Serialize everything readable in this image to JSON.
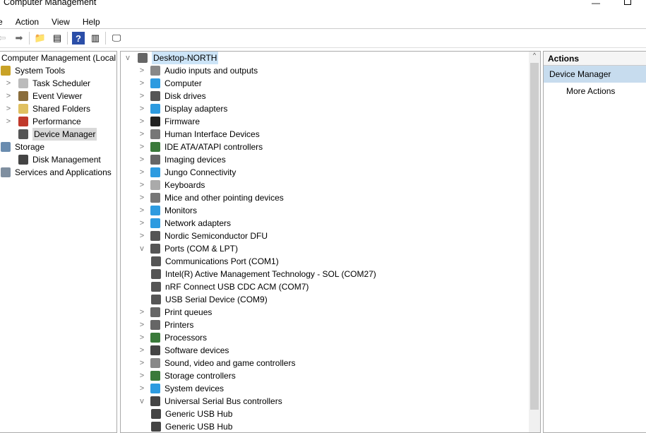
{
  "window": {
    "title": "Computer Management"
  },
  "menu": [
    "e",
    "Action",
    "View",
    "Help"
  ],
  "toolbar": [
    "back-icon",
    "forward-icon",
    "up-folder-icon",
    "show-hide-tree-icon",
    "help-icon",
    "show-hide-action-pane-icon",
    "monitor-icon"
  ],
  "left_tree": [
    {
      "label": "Computer Management (Local",
      "level": 0,
      "chev": ""
    },
    {
      "label": "System Tools",
      "level": 1,
      "chev": "",
      "color": "#c9a227"
    },
    {
      "label": "Task Scheduler",
      "level": 2,
      "chev": ">",
      "color": "#bbbbbb"
    },
    {
      "label": "Event Viewer",
      "level": 2,
      "chev": ">",
      "color": "#8a6d3b"
    },
    {
      "label": "Shared Folders",
      "level": 2,
      "chev": ">",
      "color": "#e0c060"
    },
    {
      "label": "Performance",
      "level": 2,
      "chev": ">",
      "color": "#c0392b"
    },
    {
      "label": "Device Manager",
      "level": 2,
      "chev": "",
      "color": "#555555",
      "selected": true
    },
    {
      "label": "Storage",
      "level": 1,
      "chev": "",
      "color": "#6a8caf"
    },
    {
      "label": "Disk Management",
      "level": 2,
      "chev": "",
      "color": "#444444"
    },
    {
      "label": "Services and Applications",
      "level": 1,
      "chev": "",
      "color": "#7f8fa0"
    }
  ],
  "device_tree": {
    "root": "Desktop-NORTH",
    "items": [
      {
        "label": "Audio inputs and outputs",
        "level": 1,
        "chev": ">",
        "color": "#888888"
      },
      {
        "label": "Computer",
        "level": 1,
        "chev": ">",
        "color": "#2d9be0"
      },
      {
        "label": "Disk drives",
        "level": 1,
        "chev": ">",
        "color": "#555555"
      },
      {
        "label": "Display adapters",
        "level": 1,
        "chev": ">",
        "color": "#2d9be0"
      },
      {
        "label": "Firmware",
        "level": 1,
        "chev": ">",
        "color": "#222222"
      },
      {
        "label": "Human Interface Devices",
        "level": 1,
        "chev": ">",
        "color": "#777777"
      },
      {
        "label": "IDE ATA/ATAPI controllers",
        "level": 1,
        "chev": ">",
        "color": "#3a7a3a"
      },
      {
        "label": "Imaging devices",
        "level": 1,
        "chev": ">",
        "color": "#666666"
      },
      {
        "label": "Jungo Connectivity",
        "level": 1,
        "chev": ">",
        "color": "#2d9be0"
      },
      {
        "label": "Keyboards",
        "level": 1,
        "chev": ">",
        "color": "#aaaaaa"
      },
      {
        "label": "Mice and other pointing devices",
        "level": 1,
        "chev": ">",
        "color": "#777777"
      },
      {
        "label": "Monitors",
        "level": 1,
        "chev": ">",
        "color": "#2d9be0"
      },
      {
        "label": "Network adapters",
        "level": 1,
        "chev": ">",
        "color": "#2d9be0"
      },
      {
        "label": "Nordic Semiconductor DFU",
        "level": 1,
        "chev": ">",
        "color": "#555555"
      },
      {
        "label": "Ports (COM & LPT)",
        "level": 1,
        "chev": "v",
        "color": "#555555"
      },
      {
        "label": "Communications Port (COM1)",
        "level": 2,
        "chev": "",
        "color": "#555555"
      },
      {
        "label": "Intel(R) Active Management Technology - SOL (COM27)",
        "level": 2,
        "chev": "",
        "color": "#555555"
      },
      {
        "label": "nRF Connect USB CDC ACM (COM7)",
        "level": 2,
        "chev": "",
        "color": "#555555"
      },
      {
        "label": "USB Serial Device (COM9)",
        "level": 2,
        "chev": "",
        "color": "#555555"
      },
      {
        "label": "Print queues",
        "level": 1,
        "chev": ">",
        "color": "#666666"
      },
      {
        "label": "Printers",
        "level": 1,
        "chev": ">",
        "color": "#666666"
      },
      {
        "label": "Processors",
        "level": 1,
        "chev": ">",
        "color": "#3a7a3a"
      },
      {
        "label": "Software devices",
        "level": 1,
        "chev": ">",
        "color": "#444444"
      },
      {
        "label": "Sound, video and game controllers",
        "level": 1,
        "chev": ">",
        "color": "#888888"
      },
      {
        "label": "Storage controllers",
        "level": 1,
        "chev": ">",
        "color": "#3a7a3a"
      },
      {
        "label": "System devices",
        "level": 1,
        "chev": ">",
        "color": "#2d9be0"
      },
      {
        "label": "Universal Serial Bus controllers",
        "level": 1,
        "chev": "v",
        "color": "#444444"
      },
      {
        "label": "Generic USB Hub",
        "level": 2,
        "chev": "",
        "color": "#444444"
      },
      {
        "label": "Generic USB Hub",
        "level": 2,
        "chev": "",
        "color": "#444444"
      }
    ]
  },
  "actions": {
    "header": "Actions",
    "section": "Device Manager",
    "more": "More Actions"
  }
}
